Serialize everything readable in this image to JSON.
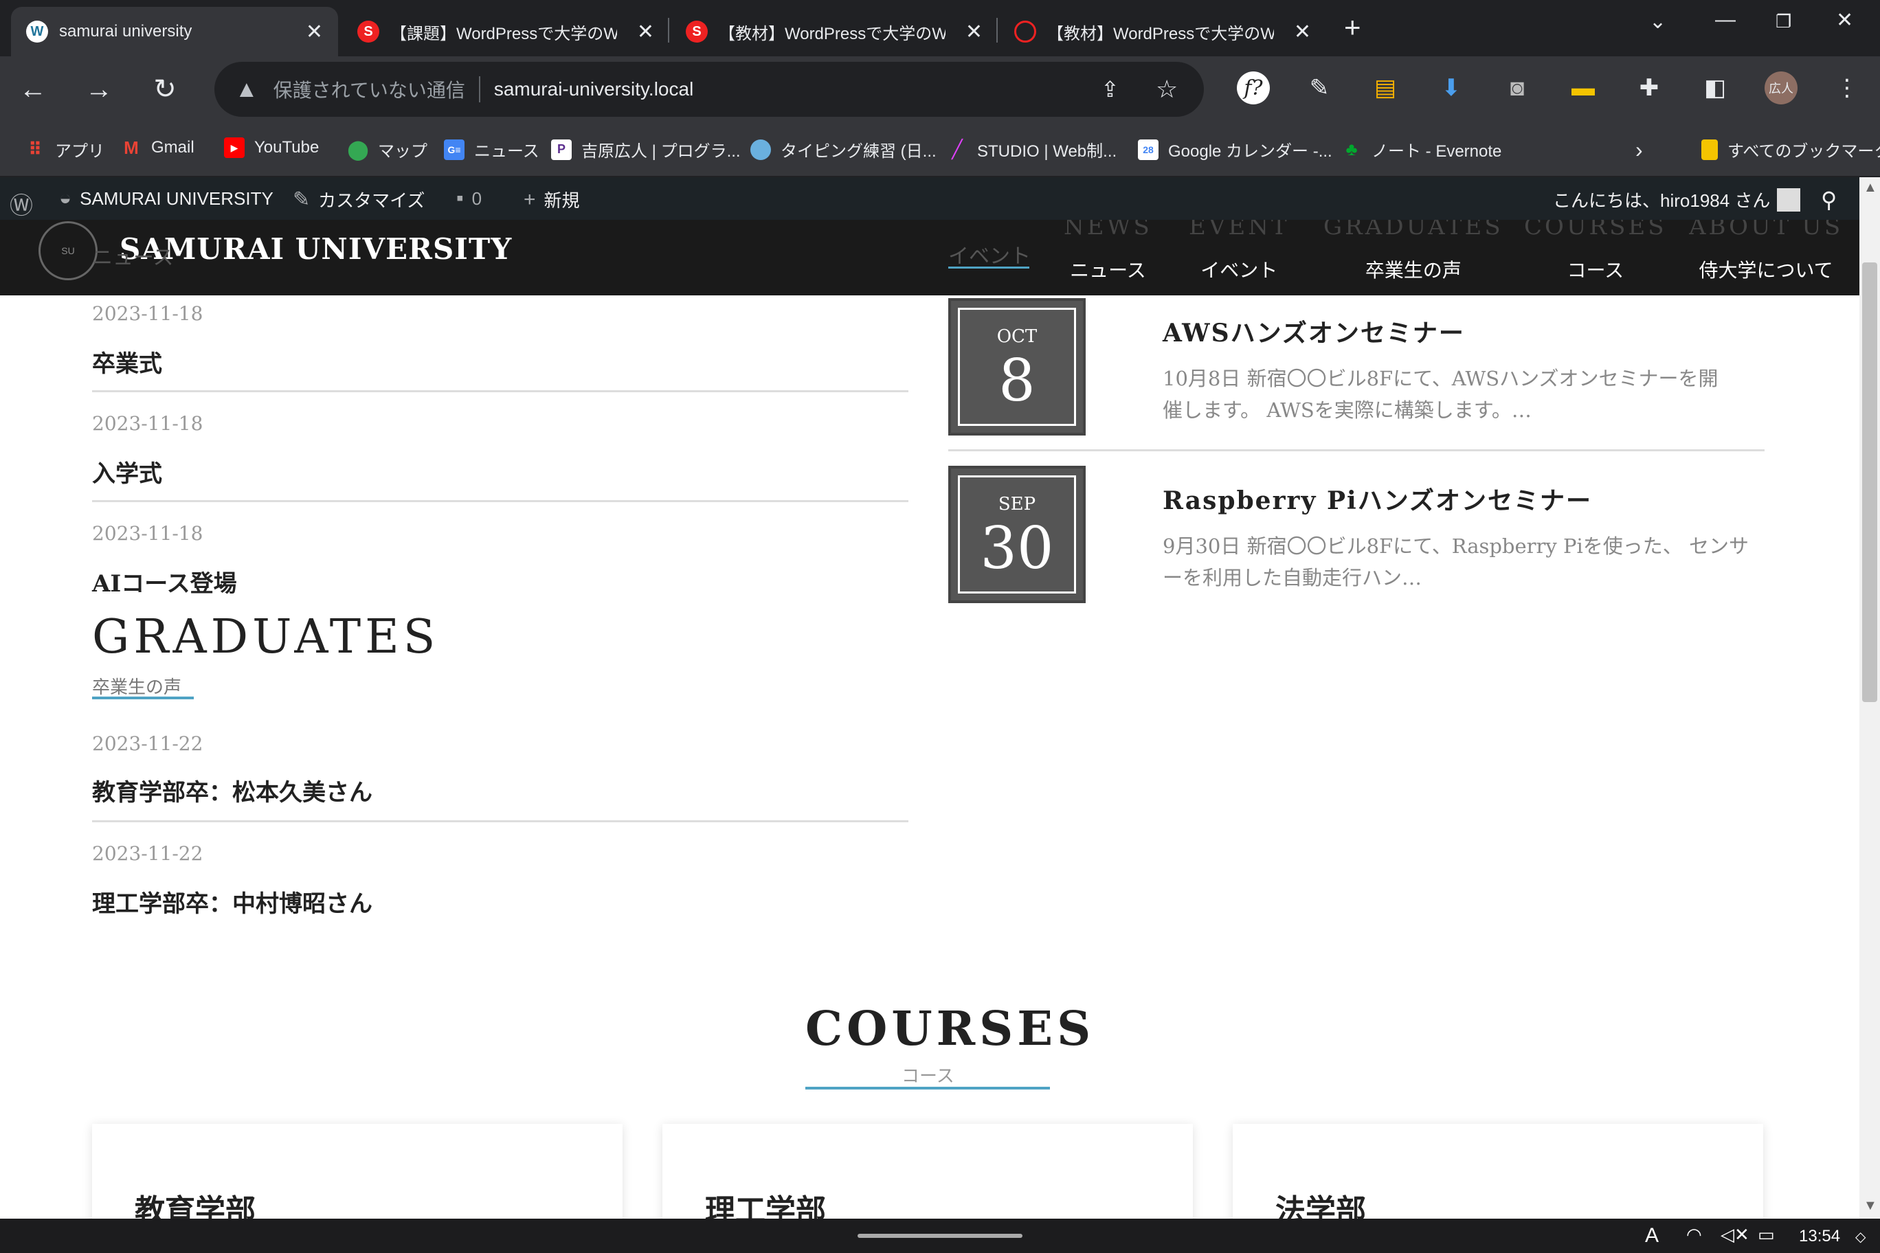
{
  "browser": {
    "tabs": [
      {
        "title": "samurai university",
        "favicon": "wordpress-icon",
        "active": true
      },
      {
        "title": "【課題】WordPressで大学のWe",
        "favicon": "samurai-icon"
      },
      {
        "title": "【教材】WordPressで大学のWe",
        "favicon": "samurai-icon"
      },
      {
        "title": "【教材】WordPressで大学のWe",
        "favicon": "samurai-loading-icon"
      }
    ],
    "address": {
      "security_text": "保護されていない通信",
      "url": "samurai-university.local"
    },
    "profile_label": "広人",
    "bookmarks": [
      {
        "label": "アプリ",
        "icon": "apps-grid-icon"
      },
      {
        "label": "Gmail",
        "icon": "gmail-icon"
      },
      {
        "label": "YouTube",
        "icon": "youtube-icon"
      },
      {
        "label": "マップ",
        "icon": "maps-icon"
      },
      {
        "label": "ニュース",
        "icon": "news-icon"
      },
      {
        "label": "吉原広人 | プログラ...",
        "icon": "p-icon"
      },
      {
        "label": "タイピング練習 (日...",
        "icon": "typing-icon"
      },
      {
        "label": "STUDIO | Web制...",
        "icon": "studio-icon"
      },
      {
        "label": "Google カレンダー -...",
        "icon": "calendar-icon"
      },
      {
        "label": "ノート - Evernote",
        "icon": "evernote-icon"
      }
    ],
    "all_bookmarks": "すべてのブックマーク"
  },
  "adminbar": {
    "site_name": "SAMURAI UNIVERSITY",
    "customize": "カスタマイズ",
    "comments_count": "0",
    "new_label": "新規",
    "greeting": "こんにちは、hiro1984 さん"
  },
  "header": {
    "site_title": "SAMURAI UNIVERSITY",
    "nav": [
      {
        "en": "NEWS",
        "ja": "ニュース"
      },
      {
        "en": "EVENT",
        "ja": "イベント"
      },
      {
        "en": "GRADUATES",
        "ja": "卒業生の声"
      },
      {
        "en": "COURSES",
        "ja": "コース"
      },
      {
        "en": "ABOUT US",
        "ja": "侍大学について"
      }
    ]
  },
  "news": {
    "subtitle_partial": "ニュース",
    "items": [
      {
        "date": "2023-11-18",
        "title": "卒業式"
      },
      {
        "date": "2023-11-18",
        "title": "入学式"
      },
      {
        "date": "2023-11-18",
        "title": "AIコース登場"
      }
    ]
  },
  "event_section": {
    "subtitle_partial": "イベント"
  },
  "events": [
    {
      "month": "OCT",
      "day": "8",
      "title": "AWSハンズオンセミナー",
      "desc_line1": "10月8日 新宿〇〇ビル8Fにて、AWSハンズオンセミナーを開",
      "desc_line2": "催します。 AWSを実際に構築します。…"
    },
    {
      "month": "SEP",
      "day": "30",
      "title": "Raspberry Piハンズオンセミナー",
      "desc_line1": "9月30日 新宿〇〇ビル8Fにて、Raspberry Piを使った、 センサ",
      "desc_line2": "ーを利用した自動走行ハン…"
    }
  ],
  "graduates": {
    "title": "GRADUATES",
    "subtitle": "卒業生の声",
    "items": [
      {
        "date": "2023-11-22",
        "title": "教育学部卒：松本久美さん"
      },
      {
        "date": "2023-11-22",
        "title": "理工学部卒：中村博昭さん"
      }
    ]
  },
  "courses": {
    "title": "COURSES",
    "subtitle": "コース",
    "cards": [
      {
        "title": "教育学部"
      },
      {
        "title": "理工学部"
      },
      {
        "title": "法学部"
      }
    ]
  },
  "taskbar": {
    "time": "13:54"
  },
  "colors": {
    "accent": "#4fa3c4",
    "header_bg": "#1a1a1a",
    "event_box": "#555555"
  }
}
